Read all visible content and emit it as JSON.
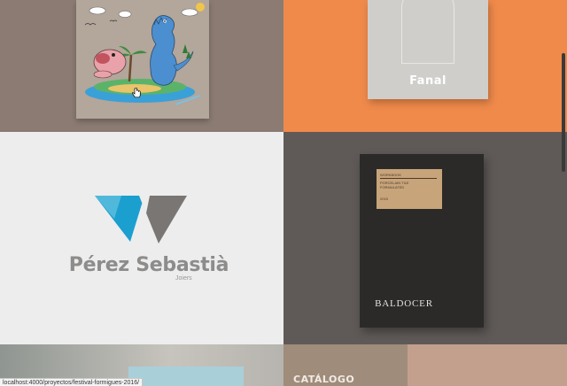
{
  "tiles": [
    {
      "id": "festival-formigues",
      "title": "",
      "kind": "illustration-book"
    },
    {
      "id": "fanal",
      "brand": "Fanal",
      "kind": "notebook"
    },
    {
      "id": "perez-sebastia",
      "name": "Pérez Sebastià",
      "subtitle": "Joiers",
      "kind": "logo"
    },
    {
      "id": "baldocer",
      "brand": "BALDOCER",
      "label_line1": "WORKBOOK",
      "label_line2": "PORCELAIN TILE FORMULATED",
      "label_line3": "2015",
      "kind": "dark-book"
    },
    {
      "id": "project-5",
      "kind": "photo"
    },
    {
      "id": "catalogo",
      "label": "CATÁLOGO",
      "kind": "photo"
    }
  ],
  "status_bar": {
    "url": "localhost:4000/proyectos/festival-formigues-2016/"
  },
  "colors": {
    "logo_blue": "#1b9fcf",
    "logo_gray": "#7a7674",
    "orange": "#f08a4b",
    "dark_book": "#2b2a29",
    "kraft_label": "#c8a47a"
  },
  "icons": {
    "cursor": "hand-pointer-icon"
  }
}
